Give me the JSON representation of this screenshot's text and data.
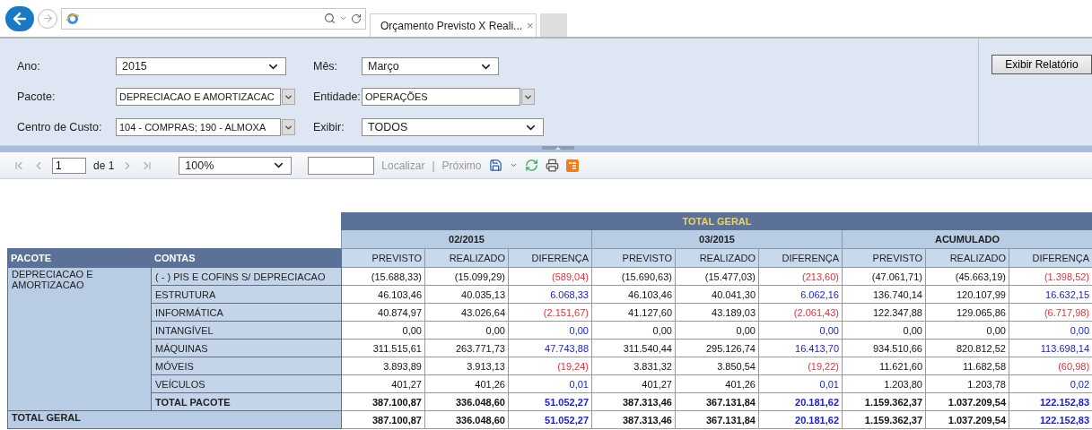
{
  "browser": {
    "tab_title": "Orçamento Previsto X Reali...",
    "tab_close": "×"
  },
  "parameter_rows": [
    [
      {
        "label": "Ano:",
        "value": "2015",
        "kind": "select"
      },
      {
        "label": "Mês:",
        "value": "Março",
        "kind": "select"
      }
    ],
    [
      {
        "label": "Pacote:",
        "value": "DEPRECIACAO E AMORTIZACAC",
        "kind": "multiselect"
      },
      {
        "label": "Entidade:",
        "value": "OPERAÇÕES",
        "kind": "multiselect"
      }
    ],
    [
      {
        "label": "Centro de Custo:",
        "value": "104 - COMPRAS; 190 - ALMOXA",
        "kind": "multiselect"
      },
      {
        "label": "Exibir:",
        "value": "TODOS",
        "kind": "select"
      }
    ]
  ],
  "run_button": "Exibir Relatório",
  "toolbar": {
    "page": "1",
    "page_of": "de 1",
    "zoom": "100%",
    "find_link": "Localizar",
    "separator": "|",
    "next_link": "Próximo"
  },
  "report": {
    "title": "TOTAL GERAL",
    "periods": [
      {
        "label": "02/2015",
        "measures": [
          "PREVISTO",
          "REALIZADO",
          "DIFERENÇA"
        ]
      },
      {
        "label": "03/2015",
        "measures": [
          "PREVISTO",
          "REALIZADO",
          "DIFERENÇA"
        ]
      },
      {
        "label": "ACUMULADO",
        "measures": [
          "PREVISTO",
          "REALIZADO",
          "DIFERENÇA"
        ]
      }
    ],
    "row_headers": [
      "PACOTE",
      "CONTAS"
    ],
    "package": "DEPRECIACAO E AMORTIZACAO",
    "rows": [
      {
        "account": "( - ) PIS E COFINS S/ DEPRECIACAO",
        "kind": "account",
        "negative": true,
        "groups": [
          [
            "(15.688,33)",
            "(15.099,29)",
            "(589,04)"
          ],
          [
            "(15.690,63)",
            "(15.477,03)",
            "(213,60)"
          ],
          [
            "(47.061,71)",
            "(45.663,19)",
            "(1.398,52)"
          ]
        ]
      },
      {
        "account": "ESTRUTURA",
        "kind": "account",
        "negative": false,
        "groups": [
          [
            "46.103,46",
            "40.035,13",
            "6.068,33"
          ],
          [
            "46.103,46",
            "40.041,30",
            "6.062,16"
          ],
          [
            "136.740,14",
            "120.107,99",
            "16.632,15"
          ]
        ]
      },
      {
        "account": "INFORMÁTICA",
        "kind": "account",
        "negative": true,
        "groups": [
          [
            "40.874,97",
            "43.026,64",
            "(2.151,67)"
          ],
          [
            "41.127,60",
            "43.189,03",
            "(2.061,43)"
          ],
          [
            "122.347,88",
            "129.065,86",
            "(6.717,98)"
          ]
        ]
      },
      {
        "account": "INTANGÍVEL",
        "kind": "account",
        "negative": false,
        "groups": [
          [
            "0,00",
            "0,00",
            "0,00"
          ],
          [
            "0,00",
            "0,00",
            "0,00"
          ],
          [
            "0,00",
            "0,00",
            "0,00"
          ]
        ]
      },
      {
        "account": "MÁQUINAS",
        "kind": "account",
        "negative": false,
        "groups": [
          [
            "311.515,61",
            "263.771,73",
            "47.743,88"
          ],
          [
            "311.540,44",
            "295.126,74",
            "16.413,70"
          ],
          [
            "934.510,66",
            "820.812,52",
            "113.698,14"
          ]
        ]
      },
      {
        "account": "MÓVEIS",
        "kind": "account",
        "negative": true,
        "groups": [
          [
            "3.893,89",
            "3.913,13",
            "(19,24)"
          ],
          [
            "3.831,32",
            "3.850,54",
            "(19,22)"
          ],
          [
            "11.621,60",
            "11.682,58",
            "(60,98)"
          ]
        ]
      },
      {
        "account": "VEÍCULOS",
        "kind": "account",
        "negative": false,
        "groups": [
          [
            "401,27",
            "401,26",
            "0,01"
          ],
          [
            "401,27",
            "401,26",
            "0,01"
          ],
          [
            "1.203,80",
            "1.203,78",
            "0,02"
          ]
        ]
      },
      {
        "account": "TOTAL PACOTE",
        "kind": "subtotal",
        "negative": false,
        "groups": [
          [
            "387.100,87",
            "336.048,60",
            "51.052,27"
          ],
          [
            "387.313,46",
            "367.131,84",
            "20.181,62"
          ],
          [
            "1.159.362,37",
            "1.037.209,54",
            "122.152,83"
          ]
        ]
      }
    ],
    "grand_total": {
      "label": "TOTAL GERAL",
      "negative": false,
      "groups": [
        [
          "387.100,87",
          "336.048,60",
          "51.052,27"
        ],
        [
          "387.313,46",
          "367.131,84",
          "20.181,62"
        ],
        [
          "1.159.362,37",
          "1.037.209,54",
          "122.152,83"
        ]
      ]
    }
  }
}
